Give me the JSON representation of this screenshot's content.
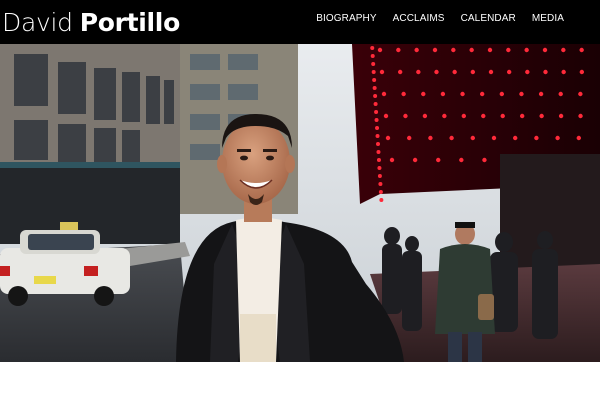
{
  "brand": {
    "first_name": "David",
    "last_name": "Portillo"
  },
  "nav": {
    "items": [
      {
        "label": "BIOGRAPHY"
      },
      {
        "label": "ACCLAIMS"
      },
      {
        "label": "CALENDAR"
      },
      {
        "label": "MEDIA"
      }
    ]
  },
  "hero": {
    "image": "portrait-of-singer-on-city-street-at-night",
    "slides_total": 4,
    "active_slide": 1
  },
  "colors": {
    "topbar": "#000000",
    "text": "#ffffff",
    "marquee_lights": "#ff2a3a"
  }
}
